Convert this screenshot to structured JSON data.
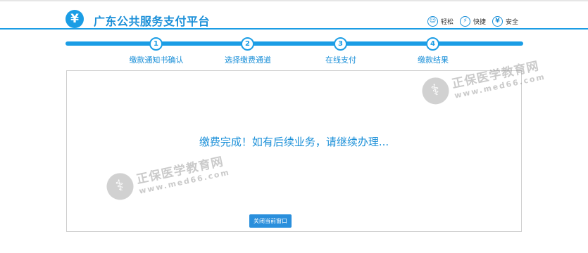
{
  "header": {
    "logo_glyph": "¥",
    "title": "广东公共服务支付平台",
    "features": [
      {
        "icon": "smile-icon",
        "glyph": "☺",
        "label": "轻松"
      },
      {
        "icon": "lightning-icon",
        "glyph": "⚡",
        "label": "快捷"
      },
      {
        "icon": "shield-yen-icon",
        "glyph": "¥",
        "label": "安全"
      }
    ]
  },
  "steps": [
    {
      "number": "1",
      "label": "缴款通知书确认"
    },
    {
      "number": "2",
      "label": "选择缴费通道"
    },
    {
      "number": "3",
      "label": "在线支付"
    },
    {
      "number": "4",
      "label": "缴款结果"
    }
  ],
  "main": {
    "message": "缴费完成！如有后续业务，请继续办理...",
    "close_button": "关闭当前窗口"
  },
  "watermark": {
    "name": "正保医学教育网",
    "url": "www.med66.com"
  },
  "colors": {
    "accent": "#1b9de5",
    "button": "#2a8fdc"
  }
}
